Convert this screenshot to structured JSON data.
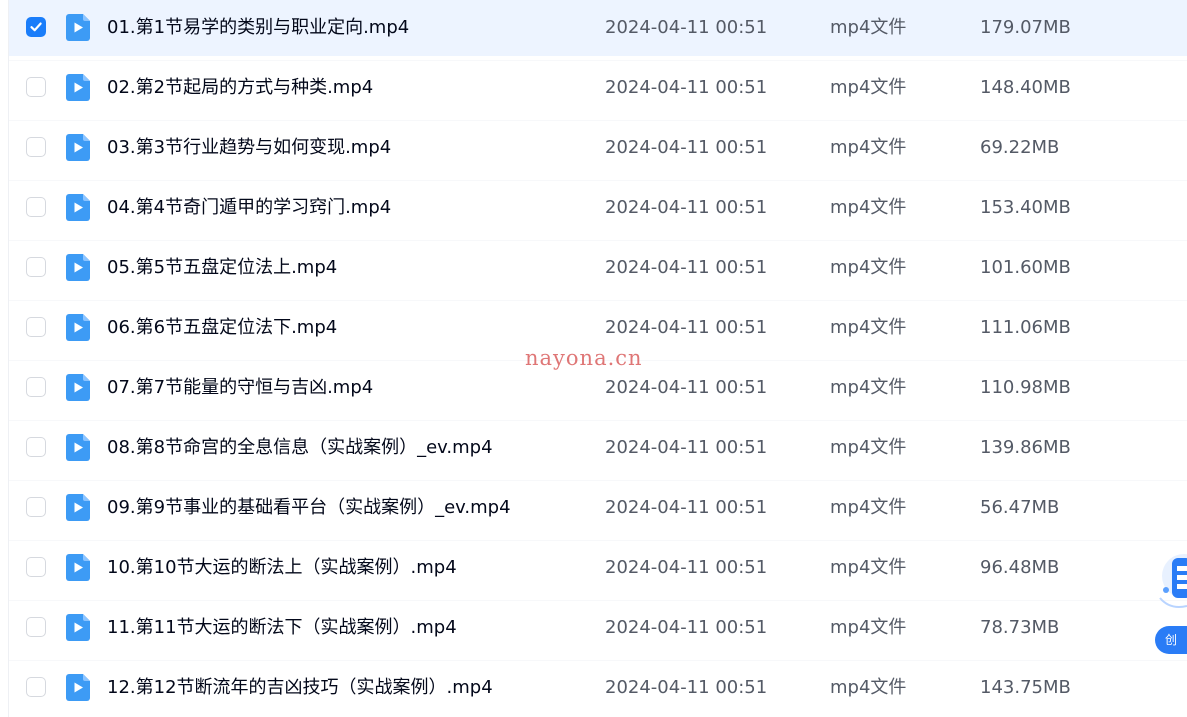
{
  "files": [
    {
      "name": "01.第1节易学的类别与职业定向.mp4",
      "date": "2024-04-11 00:51",
      "type": "mp4文件",
      "size": "179.07MB",
      "checked": true
    },
    {
      "name": "02.第2节起局的方式与种类.mp4",
      "date": "2024-04-11 00:51",
      "type": "mp4文件",
      "size": "148.40MB",
      "checked": false
    },
    {
      "name": "03.第3节行业趋势与如何变现.mp4",
      "date": "2024-04-11 00:51",
      "type": "mp4文件",
      "size": "69.22MB",
      "checked": false
    },
    {
      "name": "04.第4节奇门遁甲的学习窍门.mp4",
      "date": "2024-04-11 00:51",
      "type": "mp4文件",
      "size": "153.40MB",
      "checked": false
    },
    {
      "name": "05.第5节五盘定位法上.mp4",
      "date": "2024-04-11 00:51",
      "type": "mp4文件",
      "size": "101.60MB",
      "checked": false
    },
    {
      "name": "06.第6节五盘定位法下.mp4",
      "date": "2024-04-11 00:51",
      "type": "mp4文件",
      "size": "111.06MB",
      "checked": false
    },
    {
      "name": "07.第7节能量的守恒与吉凶.mp4",
      "date": "2024-04-11 00:51",
      "type": "mp4文件",
      "size": "110.98MB",
      "checked": false
    },
    {
      "name": "08.第8节命宫的全息信息（实战案例）_ev.mp4",
      "date": "2024-04-11 00:51",
      "type": "mp4文件",
      "size": "139.86MB",
      "checked": false
    },
    {
      "name": "09.第9节事业的基础看平台（实战案例）_ev.mp4",
      "date": "2024-04-11 00:51",
      "type": "mp4文件",
      "size": "56.47MB",
      "checked": false
    },
    {
      "name": "10.第10节大运的断法上（实战案例）.mp4",
      "date": "2024-04-11 00:51",
      "type": "mp4文件",
      "size": "96.48MB",
      "checked": false
    },
    {
      "name": "11.第11节大运的断法下（实战案例）.mp4",
      "date": "2024-04-11 00:51",
      "type": "mp4文件",
      "size": "78.73MB",
      "checked": false
    },
    {
      "name": "12.第12节断流年的吉凶技巧（实战案例）.mp4",
      "date": "2024-04-11 00:51",
      "type": "mp4文件",
      "size": "143.75MB",
      "checked": false
    }
  ],
  "watermark": "nayona.cn",
  "float_widget": {
    "label": "创"
  },
  "colors": {
    "accent": "#1a7dfa",
    "selected_row_bg": "#edf4ff",
    "video_icon": "#3d9bf5"
  },
  "icons": {
    "file": "video-file-icon",
    "check": "checkmark-icon"
  }
}
